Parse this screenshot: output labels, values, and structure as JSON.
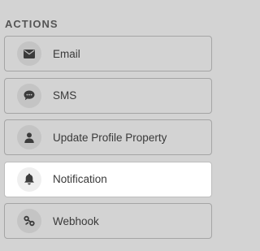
{
  "actions_panel": {
    "title": "ACTIONS",
    "items": [
      {
        "label": "Email",
        "icon": "envelope-icon",
        "selected": false
      },
      {
        "label": "SMS",
        "icon": "chat-bubble-icon",
        "selected": false
      },
      {
        "label": "Update Profile Property",
        "icon": "user-icon",
        "selected": false
      },
      {
        "label": "Notification",
        "icon": "bell-icon",
        "selected": true
      },
      {
        "label": "Webhook",
        "icon": "webhook-link-icon",
        "selected": false
      }
    ]
  },
  "colors": {
    "background": "#d3d3d3",
    "selected_background": "#ffffff",
    "icon": "#3c3c3c",
    "text": "#3a3a3a",
    "title": "#555555"
  }
}
